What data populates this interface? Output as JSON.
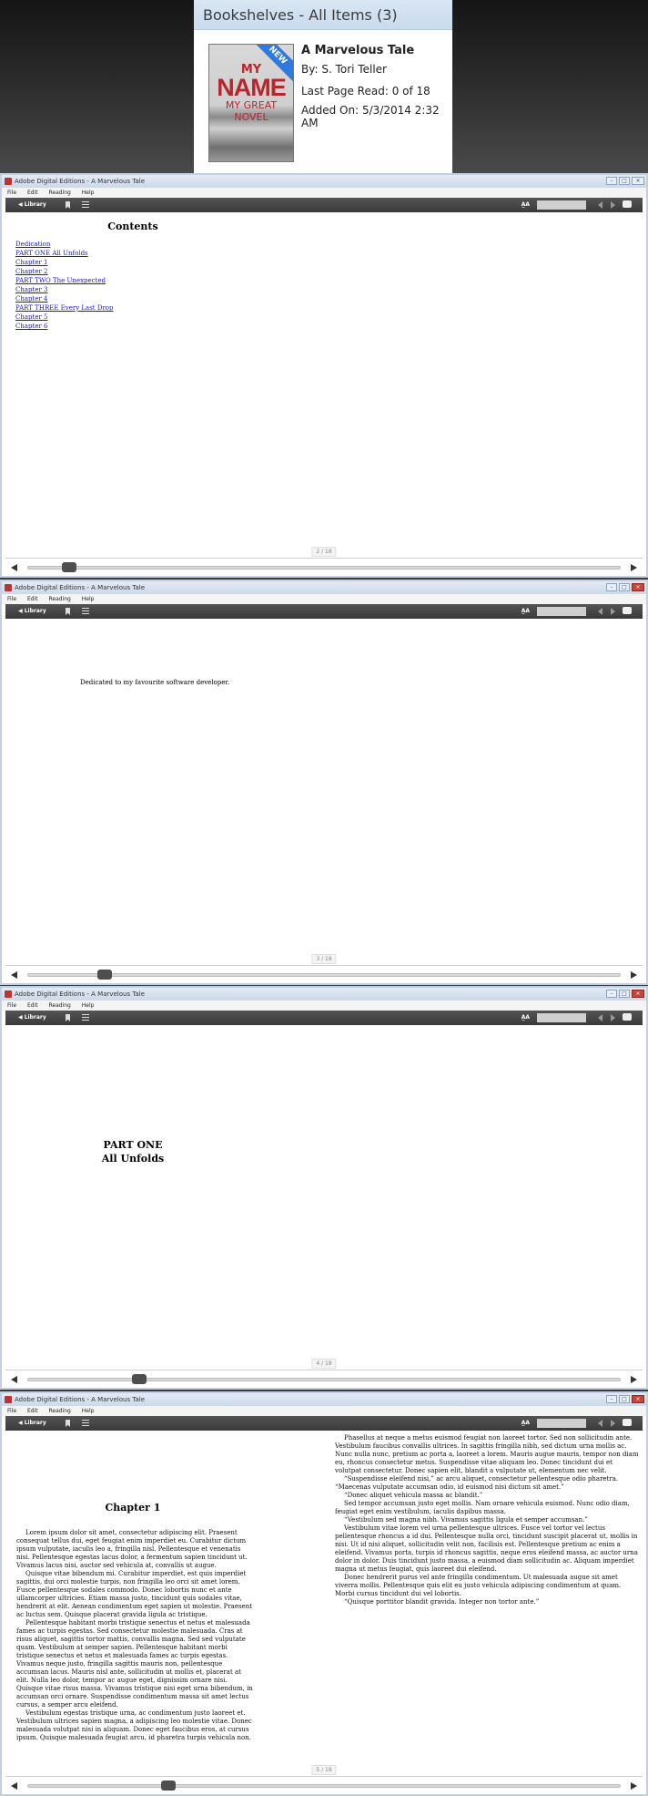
{
  "bookshelf": {
    "title": "Bookshelves - All Items (3)",
    "book": {
      "cover": {
        "top": "MY",
        "name": "NAME",
        "subtitle": "MY GREAT NOVEL",
        "badge": "NEW"
      },
      "title": "A Marvelous Tale",
      "by_label": "By:",
      "author": "S. Tori Teller",
      "last_page_label": "Last Page Read:",
      "last_page": "0 of 18",
      "added_label": "Added On:",
      "added_on": "5/3/2014 2:32 AM"
    }
  },
  "window": {
    "title": "Adobe Digital Editions - A Marvelous Tale",
    "menu": [
      "File",
      "Edit",
      "Reading",
      "Help"
    ],
    "library_label": "◀ Library",
    "font_size_label": "A̲A"
  },
  "pages": [
    {
      "kind": "contents",
      "current": "2",
      "total": "/ 18",
      "slider_fraction": 0.06,
      "heading": "Contents",
      "links": [
        "Dedication",
        "PART ONE All Unfolds",
        "Chapter 1",
        "Chapter 2",
        "PART TWO The Unexpected",
        "Chapter 3",
        "Chapter 4",
        "PART THREE Every Last Drop",
        "Chapter 5",
        "Chapter 6"
      ]
    },
    {
      "kind": "dedication",
      "current": "3",
      "total": "/ 18",
      "slider_fraction": 0.12,
      "text": "Dedicated to my favourite software developer."
    },
    {
      "kind": "part",
      "current": "4",
      "total": "/ 18",
      "slider_fraction": 0.18,
      "line1": "PART ONE",
      "line2": "All Unfolds"
    },
    {
      "kind": "chapter",
      "current": "5",
      "total": "/ 18",
      "slider_fraction": 0.23,
      "heading": "Chapter 1",
      "left": [
        "Lorem ipsum dolor sit amet, consectetur adipiscing elit. Praesent consequat tellus dui, eget feugiat enim imperdiet eu. Curabitur dictum ipsum vulputate, iaculis leo a, fringilla nisl. Pellentesque et venenatis nisi. Pellentesque egestas lacus dolor, a fermentum sapien tincidunt ut. Vivamus lacus nisi, auctor sed vehicula at, convallis ut augue.",
        "Quisque vitae bibendum mi. Curabitur imperdiet, est quis imperdiet sagittis, dui orci molestie turpis, non fringilla leo orci sit amet lorem. Fusce pellentesque sodales commodo. Donec lobortis nunc et ante ullamcorper ultricies. Etiam massa justo, tincidunt quis sodales vitae, hendrerit at elit. Aenean condimentum eget sapien ut molestie. Praesent ac luctus sem. Quisque placerat gravida ligula ac tristique.",
        "Pellentesque habitant morbi tristique senectus et netus et malesuada fames ac turpis egestas. Sed consectetur molestie malesuada. Cras at risus aliquet, sagittis tortor mattis, convallis magna. Sed sed vulputate quam. Vestibulum at semper sapien. Pellentesque habitant morbi tristique senectus et netus et malesuada fames ac turpis egestas. Vivamus neque justo, fringilla sagittis mauris non, pellentesque accumsan lacus. Mauris nisl ante, sollicitudin ut mollis et, placerat at elit. Nulla leo dolor, tempor ac augue eget, dignissim ornare nisi. Quisque vitae risus massa. Vivamus tristique nisi eget urna bibendum, in accumsan orci ornare. Suspendisse condimentum massa sit amet lectus cursus, a semper arcu eleifend.",
        "Vestibulum egestas tristique urna, ac condimentum justo laoreet et. Vestibulum ultrices sapien magna, a adipiscing leo molestie vitae. Donec malesuada volutpat nisi in aliquam. Donec eget faucibus eros, at cursus ipsum. Quisque malesuada feugiat arcu, id pharetra turpis vehicula non."
      ],
      "right": [
        "Phasellus at neque a metus euismod feugiat non laoreet tortor. Sed non sollicitudin ante. Vestibulum faucibus convallis ultrices. In sagittis fringilla nibh, sed dictum urna mollis ac. Nunc nulla nunc, pretium ac porta a, laoreet a lorem. Mauris augue mauris, tempor non diam eu, rhoncus consectetur metus. Suspendisse vitae aliquam leo. Donec tincidunt dui et volutpat consectetur. Donec sapien elit, blandit a vulputate ut, elementum nec velit.",
        "“Suspendisse eleifend nisi,” ac arcu aliquet, consectetur pellentesque odio pharetra. “Maecenas vulputate accumsan odio, id euismod nisi dictum sit amet.”",
        "“Donec aliquet vehicula massa ac blandit.”",
        "Sed tempor accumsan justo eget mollis. Nam ornare vehicula euismod. Nunc odio diam, feugiat eget enim vestibulum, iaculis dapibus massa.",
        "“Vestibulum sed magna nibh. Vivamus sagittis ligula et semper accumsan.”",
        "Vestibulum vitae lorem vel urna pellentesque ultrices. Fusce vel tortor vel lectus pellentesque rhoncus a id dui. Pellentesque nulla orci, tincidunt suscipit placerat ut, mollis in nisi. Ut id nisi aliquet, sollicitudin velit non, facilisis est. Pellentesque pretium ac enim a eleifend. Vivamus porta, turpis id rhoncus sagittis, neque eros eleifend massa, ac auctor urna dolor in dolor. Duis tincidunt justo massa, a euismod diam sollicitudin ac. Aliquam imperdiet magna ut metus feugiat, quis laoreet dui eleifend.",
        "Donec hendrerit purus vel ante fringilla condimentum. Ut malesuada augue sit amet viverra mollis. Pellentesque quis elit eu justo vehicula adipiscing condimentum at quam. Morbi cursus tincidunt dui vel lobortis.",
        "“Quisque porttitor blandit gravida. Integer non tortor ante.”"
      ]
    }
  ]
}
